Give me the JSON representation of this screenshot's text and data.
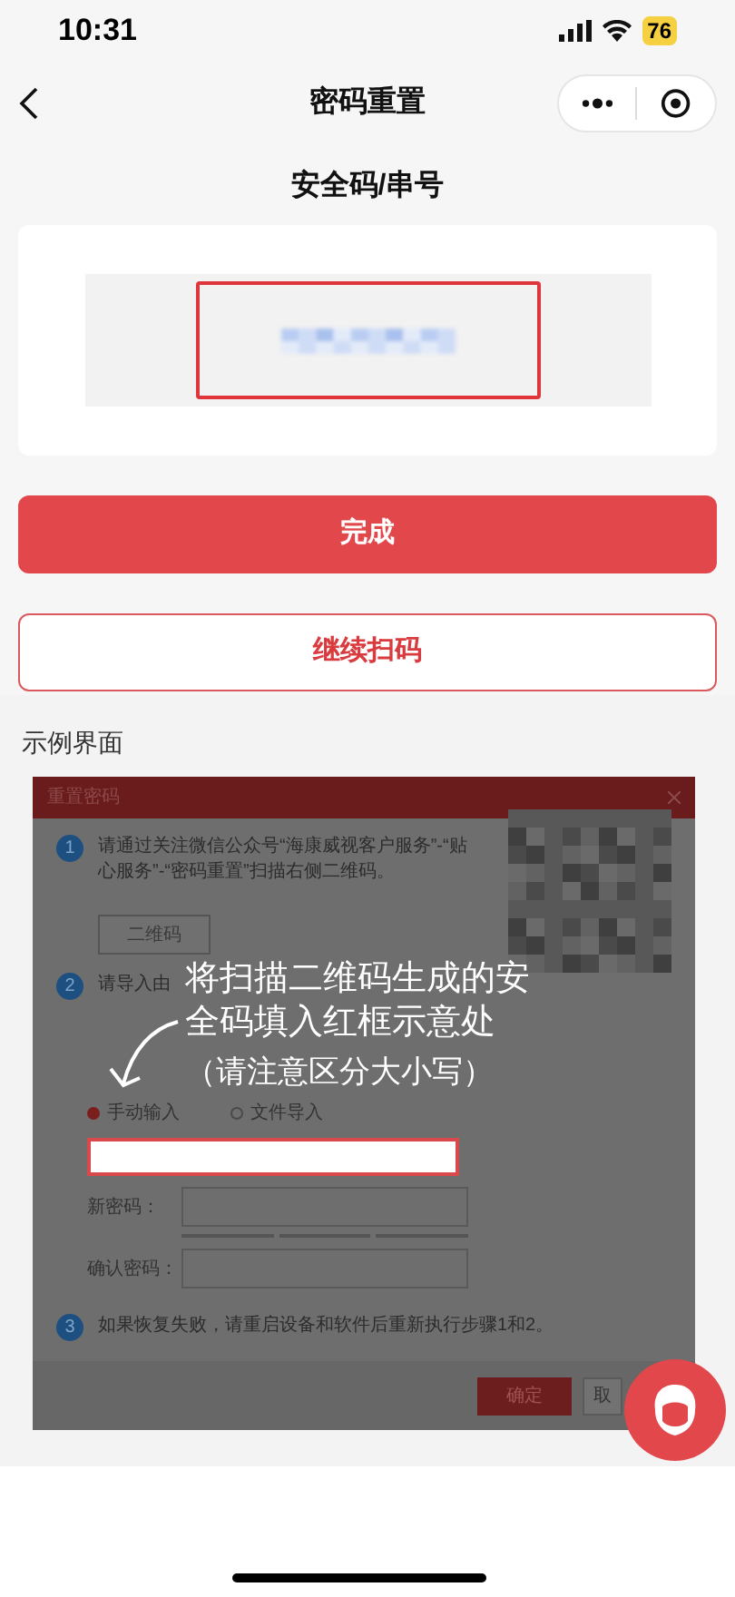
{
  "status_bar": {
    "time": "10:31",
    "battery": "76"
  },
  "nav": {
    "title": "密码重置"
  },
  "section_title": "安全码/串号",
  "buttons": [
    {
      "label": "完成",
      "kind": "primary"
    },
    {
      "label": "继续扫码",
      "kind": "outline"
    }
  ],
  "example": {
    "label": "示例界面",
    "dialog": {
      "title": "重置密码",
      "steps": [
        {
          "number": "1",
          "text": "请通过关注微信公众号“海康威视客户服务”-“贴心服务”-“密码重置”扫描右侧二维码。"
        },
        {
          "number": "2",
          "text": "请导入由"
        },
        {
          "number": "3",
          "text": "如果恢复失败，请重启设备和软件后重新执行步骤1和2。"
        }
      ],
      "qr_button": "二维码",
      "radios": [
        {
          "label": "手动输入",
          "selected": true
        },
        {
          "label": "文件导入",
          "selected": false
        }
      ],
      "fields": [
        {
          "label": "新密码：",
          "strength": true
        },
        {
          "label": "确认密码：",
          "strength": false
        }
      ],
      "confirm": "确定",
      "cancel": "取"
    },
    "annotation": {
      "text": "将扫描二维码生成的安全码填入红框示意处",
      "note": "（请注意区分大小写）"
    }
  }
}
